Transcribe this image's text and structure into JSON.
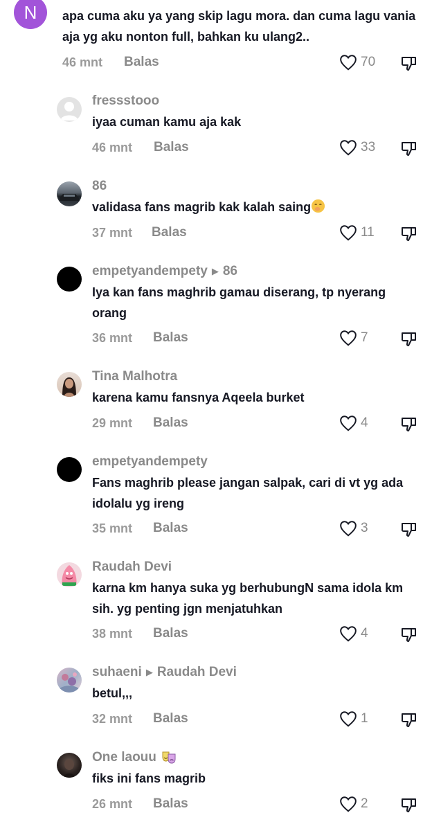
{
  "reply_label": "Balas",
  "colors": {
    "text": "#161823",
    "meta": "#8a8a8a",
    "n_avatar": "#a254d9"
  },
  "comments": [
    {
      "id": "c0",
      "avatar": "letter-N",
      "avatar_letter": "N",
      "username": "",
      "text_lines": [
        "apa cuma aku ya yang skip lagu mora. dan cuma lagu vania",
        "aja yg aku nonton full, bahkan ku ulang2.."
      ],
      "time": "46 mnt",
      "likes": "70"
    },
    {
      "id": "c1",
      "avatar": "default-gray",
      "username": "fressstooo",
      "text_lines": [
        "iyaa cuman kamu aja kak"
      ],
      "time": "46 mnt",
      "likes": "33"
    },
    {
      "id": "c2",
      "avatar": "car-photo",
      "username": "86",
      "text_lines": [
        "validasa fans magrib kak kalah saing"
      ],
      "emoji": "shushing-face",
      "time": "37 mnt",
      "likes": "11"
    },
    {
      "id": "c3",
      "avatar": "black-circle",
      "username": "empetyandempety",
      "reply_to": "86",
      "text_lines": [
        "Iya kan fans maghrib gamau diserang, tp nyerang",
        "orang"
      ],
      "time": "36 mnt",
      "likes": "7"
    },
    {
      "id": "c4",
      "avatar": "portrait-photo",
      "username": "Tina Malhotra",
      "text_lines": [
        "karena kamu fansnya Aqeela burket"
      ],
      "time": "29 mnt",
      "likes": "4"
    },
    {
      "id": "c5",
      "avatar": "black-circle",
      "username": "empetyandempety",
      "text_lines": [
        "Fans maghrib please jangan salpak, cari di vt yg ada",
        "idolalu yg ireng"
      ],
      "time": "35 mnt",
      "likes": "3"
    },
    {
      "id": "c6",
      "avatar": "pink-cartoon",
      "username": "Raudah Devi",
      "text_lines": [
        "karna km hanya suka yg berhubungN sama idola km",
        "sih. yg penting jgn menjatuhkan"
      ],
      "time": "38 mnt",
      "likes": "4"
    },
    {
      "id": "c7",
      "avatar": "flowers-photo",
      "username": "suhaeni",
      "reply_to": "Raudah Devi",
      "text_lines": [
        "betul,,,"
      ],
      "time": "32 mnt",
      "likes": "1"
    },
    {
      "id": "c8",
      "avatar": "dark-photo",
      "username": "One laouu",
      "username_emoji": "theater-masks",
      "text_lines": [
        "fiks ini fans magrib"
      ],
      "time": "26 mnt",
      "likes": "2"
    }
  ]
}
